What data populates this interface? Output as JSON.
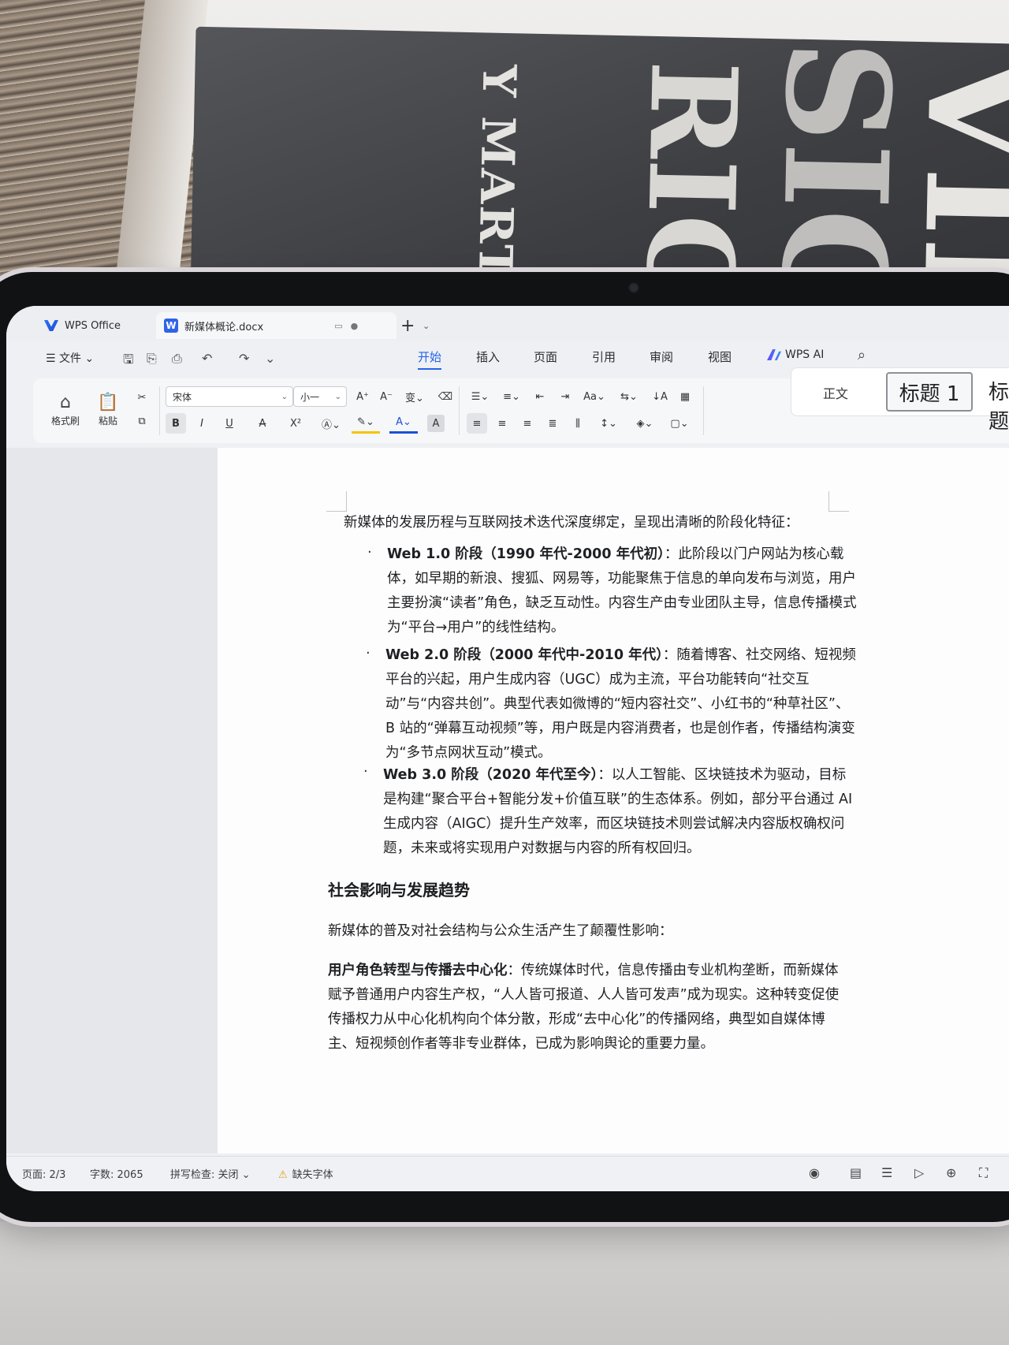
{
  "background": {
    "book_author": "Y MARTIN",
    "book_word_1": "RIOR",
    "book_word_2": "SIGN",
    "book_word_3": "VIEW"
  },
  "tabs": {
    "app_tab": "WPS Office",
    "doc_tab": "新媒体概论.docx",
    "doc_icon_letter": "W",
    "add_tab": "+"
  },
  "menu": {
    "file": "文件",
    "ribbon_tabs": [
      "开始",
      "插入",
      "页面",
      "引用",
      "审阅",
      "视图"
    ],
    "wps_ai": "WPS AI"
  },
  "ribbon": {
    "format_painter": "格式刷",
    "paste": "粘贴",
    "font_name": "宋体",
    "font_size": "小一",
    "bold": "B",
    "italic": "I",
    "underline": "U",
    "strike": "A",
    "superscript": "X²",
    "styles": {
      "normal": "正文",
      "heading1": "标题 1",
      "heading2": "标题"
    }
  },
  "document": {
    "intro": "新媒体的发展历程与互联网技术迭代深度绑定，呈现出清晰的阶段化特征：",
    "bullets": [
      {
        "title": "Web 1.0 阶段（1990 年代-2000 年代初）",
        "text": "：此阶段以门户网站为核心载体，如早期的新浪、搜狐、网易等，功能聚焦于信息的单向发布与浏览，用户主要扮演“读者”角色，缺乏互动性。内容生产由专业团队主导，信息传播模式为“平台→用户”的线性结构。"
      },
      {
        "title": "Web 2.0 阶段（2000 年代中-2010 年代）",
        "text": "：随着博客、社交网络、短视频平台的兴起，用户生成内容（UGC）成为主流，平台功能转向“社交互动”与“内容共创”。典型代表如微博的“短内容社交”、小红书的“种草社区”、B 站的“弹幕互动视频”等，用户既是内容消费者，也是创作者，传播结构演变为“多节点网状互动”模式。"
      },
      {
        "title": "Web 3.0 阶段（2020 年代至今）",
        "text": "：以人工智能、区块链技术为驱动，目标是构建“聚合平台+智能分发+价值互联”的生态体系。例如，部分平台通过 AI 生成内容（AIGC）提升生产效率，而区块链技术则尝试解决内容版权确权问题，未来或将实现用户对数据与内容的所有权回归。"
      }
    ],
    "heading": "社会影响与发展趋势",
    "social_intro": "新媒体的普及对社会结构与公众生活产生了颠覆性影响：",
    "role_title": "用户角色转型与传播去中心化",
    "role_text": "：传统媒体时代，信息传播由专业机构垄断，而新媒体赋予普通用户内容生产权，“人人皆可报道、人人皆可发声”成为现实。这种转变促使传播权力从中心化机构向个体分散，形成“去中心化”的传播网络，典型如自媒体博主、短视频创作者等非专业群体，已成为影响舆论的重要力量。"
  },
  "status": {
    "page": "页面: 2/3",
    "words": "字数: 2065",
    "spell": "拼写检查: 关闭",
    "missing_font": "缺失字体"
  }
}
